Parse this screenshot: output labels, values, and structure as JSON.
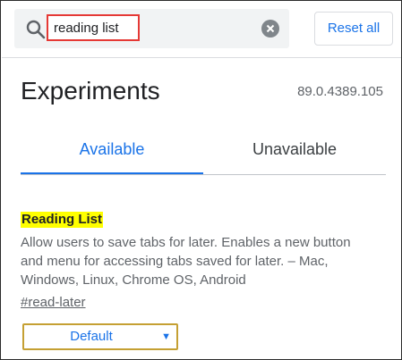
{
  "search": {
    "value": "reading list"
  },
  "header": {
    "reset_label": "Reset all"
  },
  "page": {
    "title": "Experiments",
    "version": "89.0.4389.105"
  },
  "tabs": [
    {
      "label": "Available",
      "active": true
    },
    {
      "label": "Unavailable",
      "active": false
    }
  ],
  "experiment": {
    "name": "Reading List",
    "description": "Allow users to save tabs for later. Enables a new button and menu for accessing tabs saved for later. – Mac, Windows, Linux, Chrome OS, Android",
    "link": "#read-later",
    "selected_option": "Default"
  },
  "icons": {
    "search": "search-icon",
    "clear": "clear-icon",
    "dropdown": "chevron-down-icon"
  },
  "colors": {
    "accent": "#1a73e8",
    "highlight": "#ffff00",
    "search_outline": "#e53935",
    "select_border": "#c5a033"
  }
}
